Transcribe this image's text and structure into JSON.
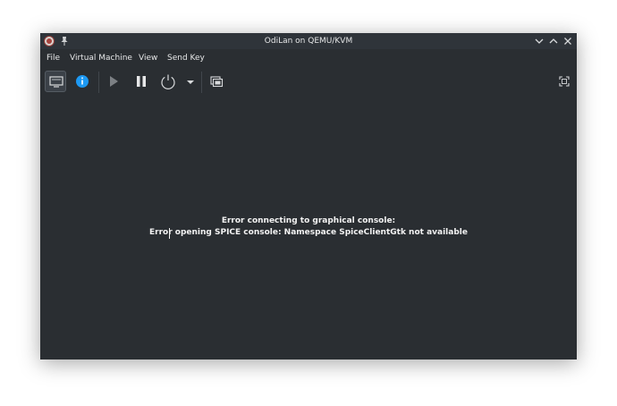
{
  "window": {
    "title": "OdiLan on QEMU/KVM",
    "controls": [
      "minimize",
      "maximize",
      "close"
    ]
  },
  "menu": {
    "items": [
      "File",
      "Virtual Machine",
      "View",
      "Send Key"
    ]
  },
  "toolbar": {
    "buttons": [
      {
        "icon": "monitor-icon",
        "active": true
      },
      {
        "icon": "info-icon",
        "active": false
      },
      {
        "icon": "play-icon",
        "active": false
      },
      {
        "icon": "pause-icon",
        "active": false
      },
      {
        "icon": "power-icon",
        "active": false
      },
      {
        "icon": "chevron-down-icon",
        "active": false
      },
      {
        "icon": "snapshots-icon",
        "active": false
      },
      {
        "icon": "fullscreen-icon",
        "active": false
      }
    ]
  },
  "console": {
    "error_title": "Error connecting to graphical console:",
    "error_detail": "Error opening SPICE console: Namespace SpiceClientGtk not available"
  },
  "colors": {
    "window_bg": "#2a2e32",
    "titlebar_bg": "#2f343a",
    "text": "#e6e7e8",
    "info_blue": "#1d99f3"
  }
}
